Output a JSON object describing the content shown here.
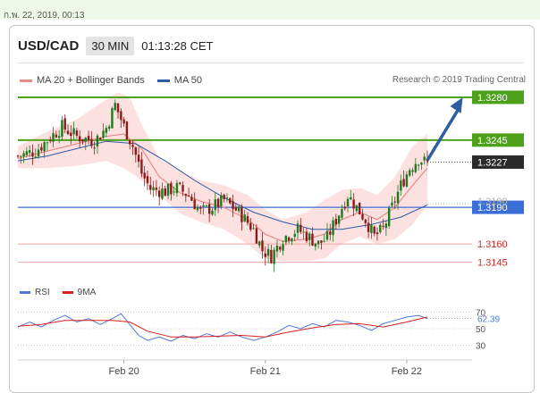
{
  "date_strip": {
    "text": "ก.พ. 22, 2019, 00:13"
  },
  "header": {
    "symbol": "USD/CAD",
    "timeframe": "30 MIN",
    "time": "01:13:28 CET"
  },
  "legend": {
    "items": [
      {
        "label": "MA 20 + Bollinger Bands",
        "color": "#e88a8a"
      },
      {
        "label": "MA 50",
        "color": "#2a5ca8"
      }
    ],
    "credit": "Research © 2019 Trading Central"
  },
  "rsi_legend": {
    "items": [
      {
        "label": "RSI",
        "color": "#4f78d8"
      },
      {
        "label": "9MA",
        "color": "#d92020"
      }
    ]
  },
  "colors": {
    "resistance": "#4ea21b",
    "pivot": "#3a6fd8",
    "support": "#f2a5a5",
    "support_label": "#d22b2b",
    "current_bg": "#2b2b2b",
    "bollinger_fill": "#fde0e0",
    "ma20": "#e88a8a",
    "ma50": "#2a5ca8",
    "candle_up": "#1f7a1f",
    "candle_down": "#8b1a1a",
    "arrow": "#2d5fa0"
  },
  "chart_data": {
    "type": "candlestick",
    "symbol": "USD/CAD",
    "timeframe": "30 MIN",
    "x_ticks": [
      {
        "label": "Feb 20",
        "index": 36
      },
      {
        "label": "Feb 21",
        "index": 84
      },
      {
        "label": "Feb 22",
        "index": 132
      }
    ],
    "ylim": [
      1.3136,
      1.3288
    ],
    "levels": [
      {
        "value": 1.328,
        "label": "1.3280",
        "kind": "resistance"
      },
      {
        "value": 1.3245,
        "label": "1.3245",
        "kind": "resistance"
      },
      {
        "value": 1.3227,
        "label": "1.3227",
        "kind": "current"
      },
      {
        "value": 1.319,
        "label": "1.3190",
        "kind": "pivot"
      },
      {
        "value": 1.316,
        "label": "1.3160",
        "kind": "support"
      },
      {
        "value": 1.3145,
        "label": "1.3145",
        "kind": "support"
      }
    ],
    "hidden_level": {
      "value": 1.319,
      "label": "1.3190"
    },
    "close_path": [
      [
        0,
        1.3232
      ],
      [
        6,
        1.3236
      ],
      [
        10,
        1.3245
      ],
      [
        15,
        1.3256
      ],
      [
        20,
        1.3248
      ],
      [
        26,
        1.3244
      ],
      [
        30,
        1.3255
      ],
      [
        33,
        1.3274
      ],
      [
        36,
        1.3256
      ],
      [
        39,
        1.324
      ],
      [
        42,
        1.3218
      ],
      [
        45,
        1.3205
      ],
      [
        50,
        1.3203
      ],
      [
        54,
        1.3206
      ],
      [
        58,
        1.32
      ],
      [
        62,
        1.3186
      ],
      [
        66,
        1.319
      ],
      [
        70,
        1.3196
      ],
      [
        75,
        1.3186
      ],
      [
        80,
        1.3172
      ],
      [
        83,
        1.3155
      ],
      [
        86,
        1.315
      ],
      [
        90,
        1.3165
      ],
      [
        95,
        1.3172
      ],
      [
        98,
        1.3167
      ],
      [
        102,
        1.316
      ],
      [
        105,
        1.3165
      ],
      [
        108,
        1.318
      ],
      [
        112,
        1.32
      ],
      [
        115,
        1.319
      ],
      [
        118,
        1.318
      ],
      [
        121,
        1.3166
      ],
      [
        124,
        1.3172
      ],
      [
        127,
        1.319
      ],
      [
        130,
        1.3208
      ],
      [
        133,
        1.3222
      ],
      [
        136,
        1.323
      ],
      [
        139,
        1.3226
      ]
    ],
    "ma20_path": [
      [
        0,
        1.323
      ],
      [
        10,
        1.3236
      ],
      [
        20,
        1.3242
      ],
      [
        30,
        1.3248
      ],
      [
        36,
        1.325
      ],
      [
        42,
        1.3238
      ],
      [
        48,
        1.3215
      ],
      [
        55,
        1.3202
      ],
      [
        62,
        1.3195
      ],
      [
        70,
        1.319
      ],
      [
        78,
        1.318
      ],
      [
        84,
        1.3168
      ],
      [
        90,
        1.3162
      ],
      [
        98,
        1.3164
      ],
      [
        104,
        1.3168
      ],
      [
        110,
        1.318
      ],
      [
        116,
        1.3186
      ],
      [
        122,
        1.318
      ],
      [
        128,
        1.319
      ],
      [
        134,
        1.3208
      ],
      [
        139,
        1.3222
      ]
    ],
    "ma50_path": [
      [
        0,
        1.3228
      ],
      [
        10,
        1.3232
      ],
      [
        20,
        1.3238
      ],
      [
        30,
        1.3244
      ],
      [
        40,
        1.3242
      ],
      [
        50,
        1.3228
      ],
      [
        60,
        1.3212
      ],
      [
        70,
        1.3198
      ],
      [
        80,
        1.3186
      ],
      [
        90,
        1.3178
      ],
      [
        100,
        1.3172
      ],
      [
        110,
        1.3172
      ],
      [
        120,
        1.3176
      ],
      [
        130,
        1.3182
      ],
      [
        139,
        1.3192
      ]
    ],
    "bollinger_upper": [
      [
        0,
        1.324
      ],
      [
        10,
        1.3252
      ],
      [
        20,
        1.3262
      ],
      [
        28,
        1.3275
      ],
      [
        34,
        1.3284
      ],
      [
        38,
        1.328
      ],
      [
        42,
        1.3258
      ],
      [
        48,
        1.323
      ],
      [
        55,
        1.322
      ],
      [
        62,
        1.3212
      ],
      [
        70,
        1.3208
      ],
      [
        78,
        1.32
      ],
      [
        84,
        1.3188
      ],
      [
        90,
        1.318
      ],
      [
        98,
        1.3186
      ],
      [
        104,
        1.3196
      ],
      [
        110,
        1.3204
      ],
      [
        116,
        1.3206
      ],
      [
        122,
        1.32
      ],
      [
        128,
        1.3215
      ],
      [
        134,
        1.324
      ],
      [
        139,
        1.325
      ]
    ],
    "bollinger_lower": [
      [
        0,
        1.3222
      ],
      [
        10,
        1.3222
      ],
      [
        20,
        1.3224
      ],
      [
        30,
        1.3228
      ],
      [
        36,
        1.3222
      ],
      [
        42,
        1.3212
      ],
      [
        48,
        1.32
      ],
      [
        55,
        1.3185
      ],
      [
        62,
        1.3178
      ],
      [
        70,
        1.3172
      ],
      [
        78,
        1.316
      ],
      [
        84,
        1.3148
      ],
      [
        90,
        1.3146
      ],
      [
        98,
        1.3146
      ],
      [
        104,
        1.3148
      ],
      [
        110,
        1.316
      ],
      [
        116,
        1.3166
      ],
      [
        122,
        1.316
      ],
      [
        128,
        1.3164
      ],
      [
        134,
        1.3176
      ],
      [
        139,
        1.3192
      ]
    ],
    "projection": {
      "from": [
        139,
        1.3227
      ],
      "to": [
        151,
        1.328
      ]
    },
    "rsi": {
      "yticks": [
        30,
        50,
        70
      ],
      "ylim": [
        20,
        80
      ],
      "current": 62.39,
      "current_label": "62.39",
      "rsi_path": [
        [
          0,
          52
        ],
        [
          4,
          58
        ],
        [
          8,
          52
        ],
        [
          12,
          60
        ],
        [
          16,
          66
        ],
        [
          20,
          58
        ],
        [
          24,
          62
        ],
        [
          28,
          55
        ],
        [
          32,
          62
        ],
        [
          35,
          68
        ],
        [
          38,
          55
        ],
        [
          41,
          42
        ],
        [
          44,
          36
        ],
        [
          48,
          40
        ],
        [
          52,
          35
        ],
        [
          56,
          42
        ],
        [
          60,
          38
        ],
        [
          64,
          44
        ],
        [
          68,
          40
        ],
        [
          72,
          46
        ],
        [
          76,
          40
        ],
        [
          80,
          36
        ],
        [
          84,
          40
        ],
        [
          88,
          46
        ],
        [
          92,
          54
        ],
        [
          96,
          50
        ],
        [
          100,
          56
        ],
        [
          104,
          52
        ],
        [
          108,
          60
        ],
        [
          112,
          58
        ],
        [
          116,
          54
        ],
        [
          120,
          48
        ],
        [
          124,
          56
        ],
        [
          128,
          60
        ],
        [
          132,
          64
        ],
        [
          136,
          66
        ],
        [
          139,
          62
        ]
      ],
      "ma_path": [
        [
          0,
          53
        ],
        [
          8,
          55
        ],
        [
          16,
          60
        ],
        [
          24,
          60
        ],
        [
          32,
          60
        ],
        [
          38,
          58
        ],
        [
          44,
          47
        ],
        [
          52,
          40
        ],
        [
          60,
          40
        ],
        [
          68,
          41
        ],
        [
          76,
          42
        ],
        [
          84,
          40
        ],
        [
          92,
          46
        ],
        [
          100,
          51
        ],
        [
          108,
          55
        ],
        [
          116,
          56
        ],
        [
          124,
          52
        ],
        [
          132,
          58
        ],
        [
          139,
          64
        ]
      ]
    }
  }
}
